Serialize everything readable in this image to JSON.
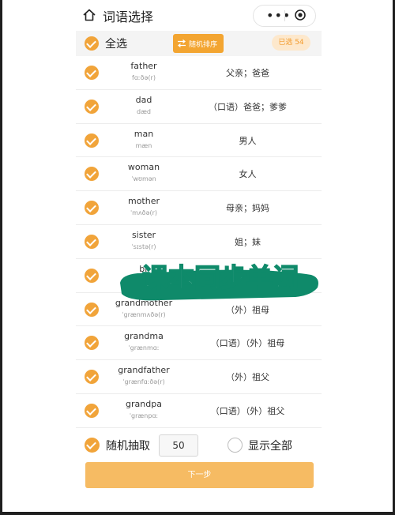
{
  "header": {
    "title": "词语选择",
    "menu_dots": "•••"
  },
  "toolbar": {
    "select_all_label": "全选",
    "shuffle_label": "随机排序",
    "selected_count": "已选 54"
  },
  "words": [
    {
      "en": "father",
      "ph": "fɑːðə(r)",
      "cn": "父亲；爸爸"
    },
    {
      "en": "dad",
      "ph": "dæd",
      "cn": "（口语）爸爸；爹爹"
    },
    {
      "en": "man",
      "ph": "mæn",
      "cn": "男人"
    },
    {
      "en": "woman",
      "ph": "ˈwʊmən",
      "cn": "女人"
    },
    {
      "en": "mother",
      "ph": "ˈmʌðə(r)",
      "cn": "母亲；妈妈"
    },
    {
      "en": "sister",
      "ph": "ˈsɪstə(r)",
      "cn": "姐；妹"
    },
    {
      "en": "br",
      "ph": "",
      "cn": ""
    },
    {
      "en": "grandmother",
      "ph": "ˈgrænmʌðə(r)",
      "cn": "（外）祖母"
    },
    {
      "en": "grandma",
      "ph": "ˈgrænmɑː",
      "cn": "（口语）（外）祖母"
    },
    {
      "en": "grandfather",
      "ph": "ˈgrænfɑːðə(r)",
      "cn": "（外）祖父"
    },
    {
      "en": "grandpa",
      "ph": "ˈgrænpɑː",
      "cn": "（口语）（外）祖父"
    }
  ],
  "watermark": {
    "text": "课本同步单词"
  },
  "bottom": {
    "random_label": "随机抽取",
    "count_value": "50",
    "show_all_label": "显示全部",
    "next_label": "下一步"
  },
  "colors": {
    "accent": "#f3a531",
    "check": "#f1a43a",
    "next_button": "#f6bb63",
    "watermark_green": "#0f8a6a"
  }
}
